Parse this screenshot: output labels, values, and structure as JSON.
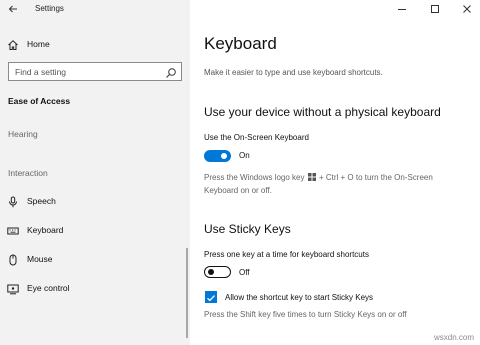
{
  "window": {
    "title": "Settings"
  },
  "sidebar": {
    "home_label": "Home",
    "search_placeholder": "Find a setting",
    "section_title": "Ease of Access",
    "groups": {
      "hearing": "Hearing",
      "interaction": "Interaction"
    },
    "items": [
      {
        "label": "Speech",
        "icon": "microphone-icon"
      },
      {
        "label": "Keyboard",
        "icon": "keyboard-icon"
      },
      {
        "label": "Mouse",
        "icon": "mouse-icon"
      },
      {
        "label": "Eye control",
        "icon": "eye-control-icon"
      }
    ]
  },
  "main": {
    "title": "Keyboard",
    "subtitle": "Make it easier to type and use keyboard shortcuts.",
    "section1": {
      "heading": "Use your device without a physical keyboard",
      "setting_label": "Use the On-Screen Keyboard",
      "toggle_on": true,
      "toggle_state": "On",
      "help_before": "Press the Windows logo key",
      "help_after": "+ Ctrl + O to turn the On-Screen",
      "help_line2": "Keyboard on or off."
    },
    "section2": {
      "heading": "Use Sticky Keys",
      "setting_label": "Press one key at a time for keyboard shortcuts",
      "toggle_on": false,
      "toggle_state": "Off",
      "checkbox_checked": true,
      "checkbox_label": "Allow the shortcut key to start Sticky Keys",
      "help": "Press the Shift key five times to turn Sticky Keys on or off"
    }
  },
  "watermark": "wsxdn.com",
  "colors": {
    "accent": "#0078d7",
    "sidebar_bg": "#f2f2f2"
  }
}
